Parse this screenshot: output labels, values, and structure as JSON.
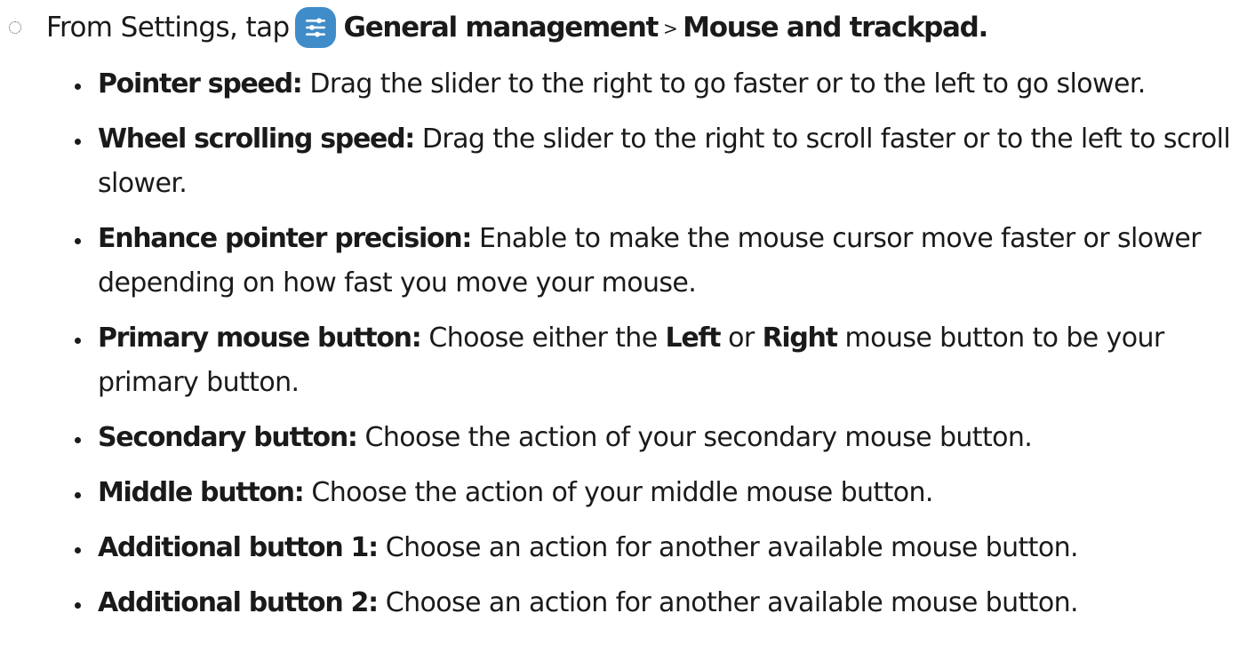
{
  "step": {
    "prefix": "From Settings, tap",
    "icon": "settings-sliders-icon",
    "icon_color": "#3f8cc9",
    "menu_path": "General management",
    "separator": ">",
    "submenu": "Mouse and trackpad."
  },
  "options": [
    {
      "name": "Pointer speed:",
      "text": " Drag the slider to the right to go faster or to the left to go slower."
    },
    {
      "name": "Wheel scrolling speed:",
      "text": " Drag the slider to the right to scroll faster or to the left to scroll slower."
    },
    {
      "name": "Enhance pointer precision:",
      "text": " Enable to make the mouse cursor move faster or slower depending on how fast you move your mouse."
    },
    {
      "name": "Primary mouse button:",
      "text_before": " Choose either the ",
      "left": "Left",
      "text_middle": " or ",
      "right": "Right",
      "text_after": " mouse button to be your primary button."
    },
    {
      "name": "Secondary button:",
      "text": " Choose the action of your secondary mouse button."
    },
    {
      "name": "Middle button:",
      "text": " Choose the action of your middle mouse button."
    },
    {
      "name": "Additional button 1:",
      "text": " Choose an action for another available mouse button."
    },
    {
      "name": "Additional button 2:",
      "text": " Choose an action for another available mouse button."
    }
  ]
}
